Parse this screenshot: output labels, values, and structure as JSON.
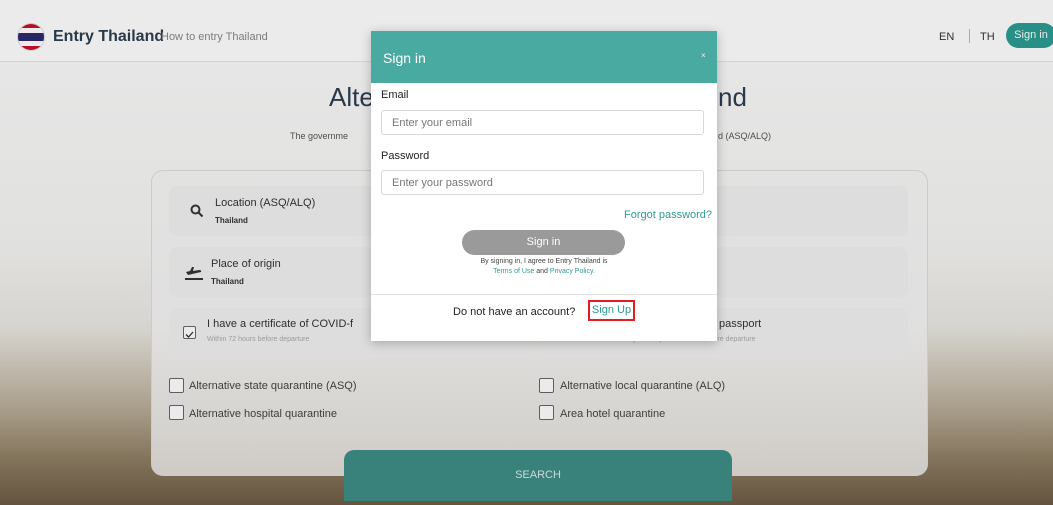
{
  "header": {
    "brand": "Entry Thailand",
    "nav_link": "How to entry Thailand",
    "lang_en": "EN",
    "lang_th": "TH",
    "sign_in_label": "Sign in"
  },
  "hero": {
    "title_left": "Alte",
    "title_right": "nd",
    "subtitle_left": "The governme",
    "subtitle_right": "d (ASQ/ALQ)"
  },
  "form": {
    "location": {
      "label": "Location (ASQ/ALQ)",
      "value": "Thailand"
    },
    "origin": {
      "label": "Place of origin",
      "value": "Thailand"
    },
    "certificate": {
      "label": "I have a certificate of COVID-f",
      "hint": "Within 72 hours before departure"
    },
    "passport": {
      "label": "passport",
      "hint": "More than 14 days and up to 3 months before departure"
    },
    "checkboxes": [
      {
        "label": "Alternative state quarantine (ASQ)"
      },
      {
        "label": "Alternative local quarantine (ALQ)"
      },
      {
        "label": "Alternative hospital quarantine"
      },
      {
        "label": "Area hotel quarantine"
      }
    ],
    "search_label": "SEARCH"
  },
  "modal": {
    "title": "Sign in",
    "close": "×",
    "email_label": "Email",
    "email_placeholder": "Enter your email",
    "password_label": "Password",
    "password_placeholder": "Enter your password",
    "forgot_label": "Forgot password?",
    "signin_label": "Sign in",
    "terms_line1": "By signing in, I agree to Entry Thailand is",
    "terms_of_use": "Terms of Use",
    "terms_and": "and",
    "privacy_policy": "Privacy Policy.",
    "no_account_text": "Do not have an account?",
    "signup_label": "Sign Up"
  },
  "colors": {
    "teal": "#48aaa1",
    "teal_dark": "#2c9c92",
    "highlight_red": "#e31c23"
  }
}
